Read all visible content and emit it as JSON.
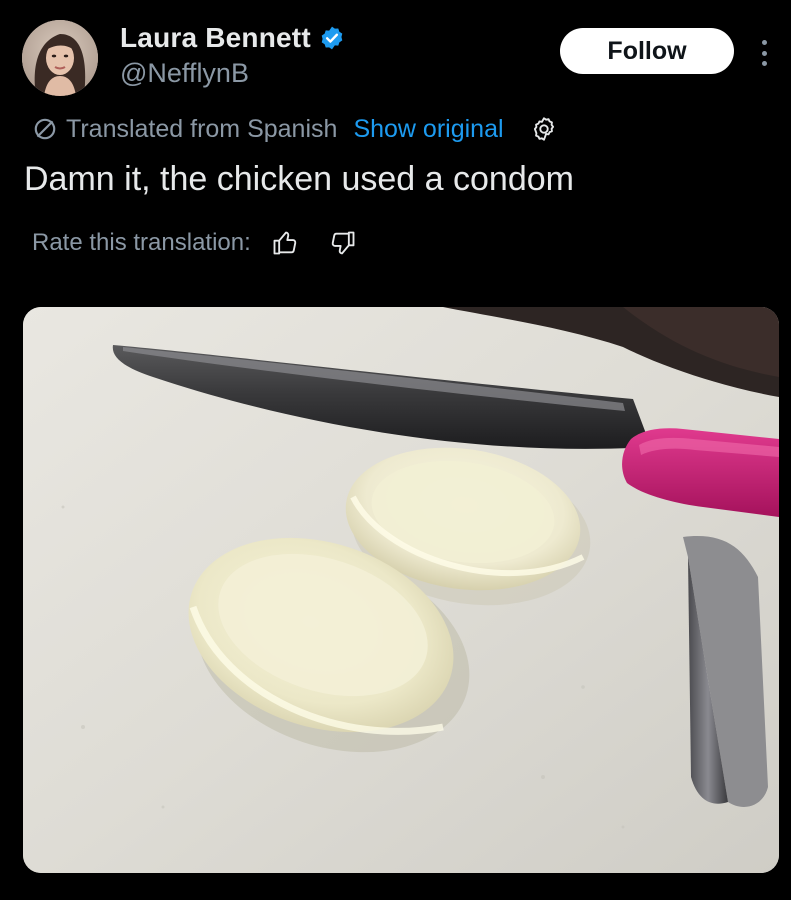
{
  "user": {
    "display_name": "Laura Bennett",
    "handle": "@NefflynB",
    "verified": true,
    "avatar_icon": "profile-photo"
  },
  "actions": {
    "follow_label": "Follow",
    "more_icon": "more-vertical-icon"
  },
  "translation": {
    "notice": "Translated from Spanish",
    "show_original": "Show original",
    "settings_icon": "gear-icon"
  },
  "tweet": {
    "text": "Damn it, the chicken used a condom"
  },
  "rating": {
    "label": "Rate this translation:",
    "up_icon": "thumbs-up-icon",
    "down_icon": "thumbs-down-icon"
  },
  "colors": {
    "background": "#000000",
    "text_primary": "#e7e9ea",
    "text_secondary": "#8b98a5",
    "link": "#1d9bf0",
    "verified": "#1d9bf0",
    "knife_handle": "#c2176f"
  }
}
